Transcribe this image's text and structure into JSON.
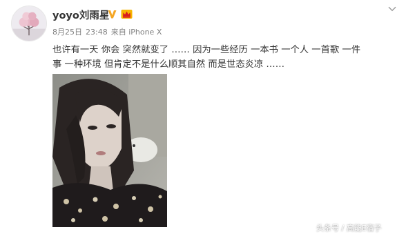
{
  "post": {
    "username": "yoyo刘雨星",
    "date": "8月25日",
    "time": "23:48",
    "source": "来自 iPhone X",
    "text_lines": [
      "也许有一天 你会 突然就变了 …… 因为一些经历 一本书 一个人 一首歌 一件",
      "事 一种环境   但肯定不是什么顺其自然 而是世态炎凉  ……"
    ]
  },
  "icons": {
    "avatar": "tree-avatar",
    "verified": "verified-v-icon",
    "member": "crown-icon",
    "menu": "chevron-down-icon"
  },
  "colors": {
    "verified": "#f5a623",
    "member": "#f7b500",
    "text": "#333333",
    "meta": "#808080"
  },
  "watermark": "头条号 / 高能E宿子"
}
